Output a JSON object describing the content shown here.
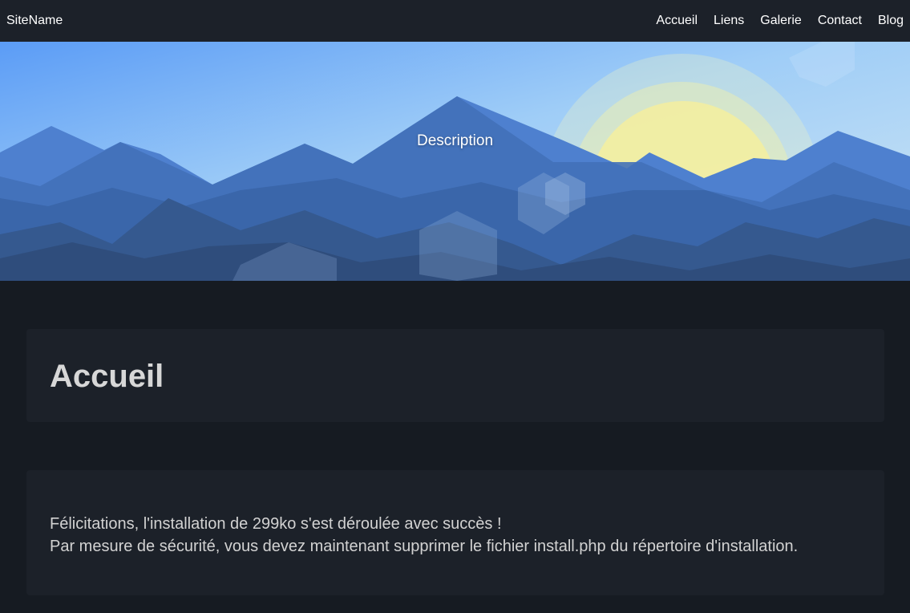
{
  "header": {
    "site_name": "SiteName",
    "nav": [
      {
        "label": "Accueil"
      },
      {
        "label": "Liens"
      },
      {
        "label": "Galerie"
      },
      {
        "label": "Contact"
      },
      {
        "label": "Blog"
      }
    ]
  },
  "hero": {
    "description": "Description"
  },
  "main": {
    "page_title": "Accueil",
    "message_line_1": "Félicitations, l'installation de 299ko s'est déroulée avec succès !",
    "message_line_2": "Par mesure de sécurité, vous devez maintenant supprimer le fichier install.php du répertoire d'installation."
  },
  "colors": {
    "background": "#161b22",
    "navbar": "#1c2129",
    "card": "#1c2129",
    "heading": "#d7d7d7",
    "text": "#d2d2d2"
  }
}
